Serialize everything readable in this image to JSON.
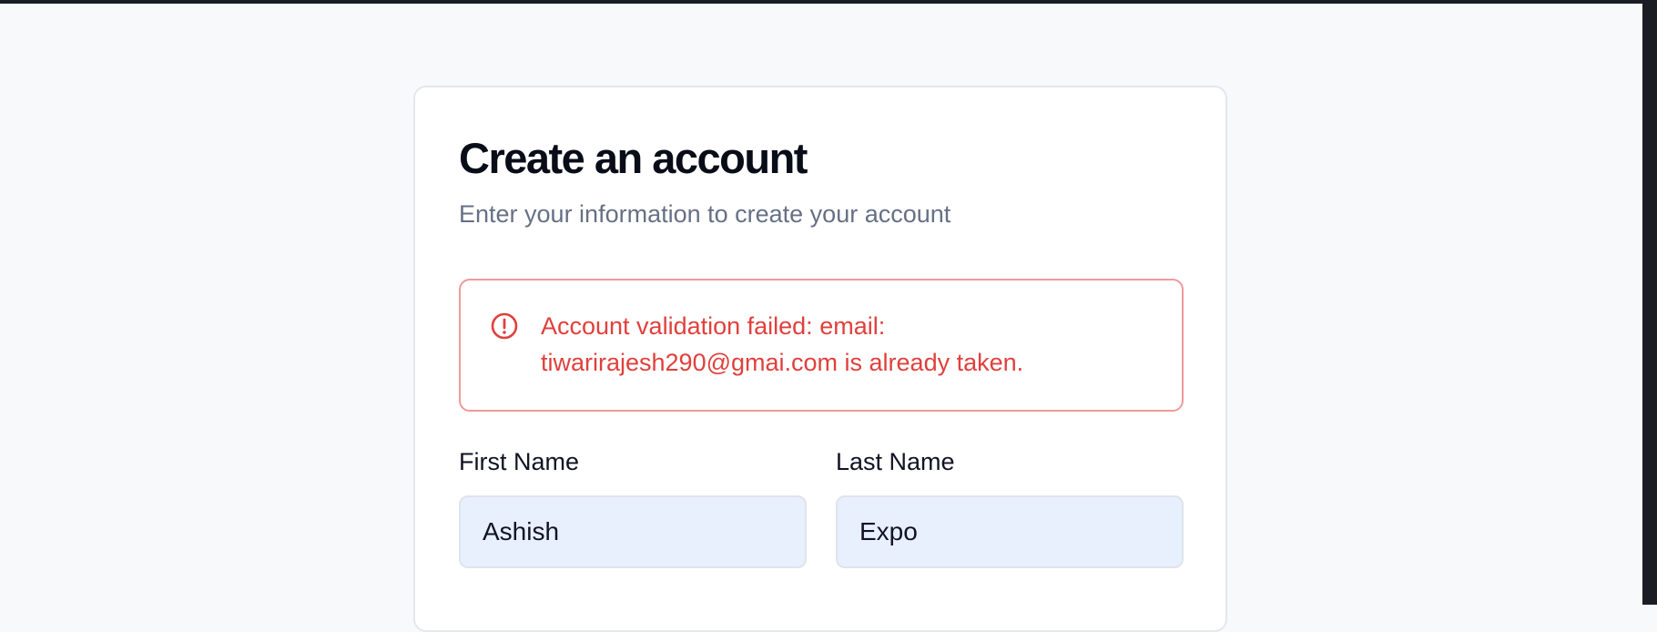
{
  "form": {
    "title": "Create an account",
    "subtitle": "Enter your information to create your account",
    "error": {
      "icon": "alert-circle-icon",
      "message": "Account validation failed: email: tiwarirajesh290@gmai.com is already taken."
    },
    "first_name": {
      "label": "First Name",
      "value": "Ashish"
    },
    "last_name": {
      "label": "Last Name",
      "value": "Expo"
    }
  },
  "colors": {
    "page_background": "#f8f9fb",
    "card_background": "#ffffff",
    "error": "#e0403c",
    "error_border": "#ef9a9a",
    "input_background": "#e8f0fe",
    "title": "#090d18",
    "subtitle": "#667085"
  }
}
